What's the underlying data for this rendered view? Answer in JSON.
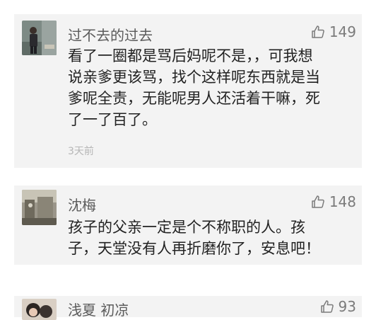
{
  "comments": [
    {
      "username": "过不去的过去",
      "likes": "149",
      "lines": [
        "看了一圈都是骂后妈呢不是，，可我想",
        "说亲爹更该骂，找个这样呢东西就是当",
        "爹呢全责，无能呢男人还活着干嘛，死",
        "了一了百了。"
      ],
      "time": "3天前"
    },
    {
      "username": "沈梅",
      "likes": "148",
      "lines": [
        "孩子的父亲一定是个不称职的人。孩",
        "子，天堂没有人再折磨你了，安息吧！"
      ]
    },
    {
      "username": "浅夏 初凉",
      "likes": "93"
    }
  ],
  "icons": {
    "like": "thumbs-up-outline-icon"
  },
  "colors": {
    "card_bg": "#f3f3f3",
    "username": "#5b5b5b",
    "text": "#222222",
    "meta": "#b6b6b6"
  }
}
